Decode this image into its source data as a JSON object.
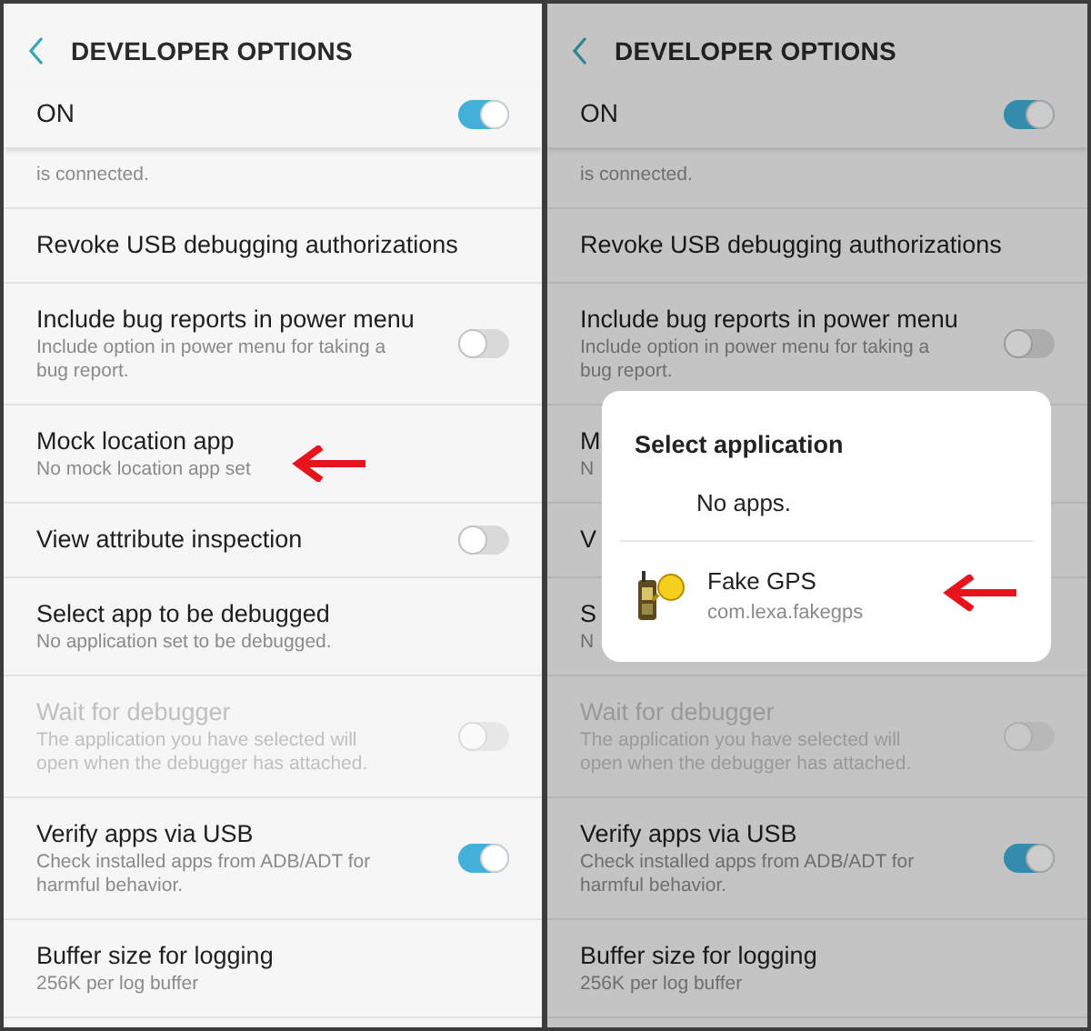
{
  "panels": [
    {
      "title": "DEVELOPER OPTIONS",
      "master": {
        "label": "ON",
        "on": true
      },
      "rows": [
        {
          "kind": "fragment",
          "subtitle": "is connected."
        },
        {
          "kind": "plain",
          "title": "Revoke USB debugging authorizations"
        },
        {
          "kind": "switch",
          "title": "Include bug reports in power menu",
          "subtitle": "Include option in power menu for taking a bug report.",
          "on": false
        },
        {
          "kind": "plain",
          "title": "Mock location app",
          "subtitle": "No mock location app set",
          "arrow": true
        },
        {
          "kind": "switch",
          "title": "View attribute inspection",
          "on": false
        },
        {
          "kind": "plain",
          "title": "Select app to be debugged",
          "subtitle": "No application set to be debugged."
        },
        {
          "kind": "switch",
          "title": "Wait for debugger",
          "subtitle": "The application you have selected will open when the debugger has attached.",
          "on": false,
          "disabled": true
        },
        {
          "kind": "switch",
          "title": "Verify apps via USB",
          "subtitle": "Check installed apps from ADB/ADT for harmful behavior.",
          "on": true
        },
        {
          "kind": "plain",
          "title": "Buffer size for logging",
          "subtitle": "256K per log buffer"
        }
      ]
    },
    {
      "title": "DEVELOPER OPTIONS",
      "master": {
        "label": "ON",
        "on": true
      },
      "rows": [
        {
          "kind": "fragment",
          "subtitle": "is connected."
        },
        {
          "kind": "plain",
          "title": "Revoke USB debugging authorizations"
        },
        {
          "kind": "switch",
          "title": "Include bug reports in power menu",
          "subtitle": "Include option in power menu for taking a bug report.",
          "on": false
        },
        {
          "kind": "plain",
          "title": "M",
          "subtitle": "N"
        },
        {
          "kind": "plain",
          "title": "V"
        },
        {
          "kind": "plain",
          "title": "S",
          "subtitle": "N"
        },
        {
          "kind": "switch",
          "title": "Wait for debugger",
          "subtitle": "The application you have selected will open when the debugger has attached.",
          "on": false,
          "disabled": true
        },
        {
          "kind": "switch",
          "title": "Verify apps via USB",
          "subtitle": "Check installed apps from ADB/ADT for harmful behavior.",
          "on": true
        },
        {
          "kind": "plain",
          "title": "Buffer size for logging",
          "subtitle": "256K per log buffer"
        }
      ],
      "dialog": {
        "title": "Select application",
        "items": [
          {
            "kind": "none",
            "label": "No apps."
          },
          {
            "kind": "app",
            "label": "Fake GPS",
            "package": "com.lexa.fakegps",
            "arrow": true
          }
        ]
      }
    }
  ]
}
